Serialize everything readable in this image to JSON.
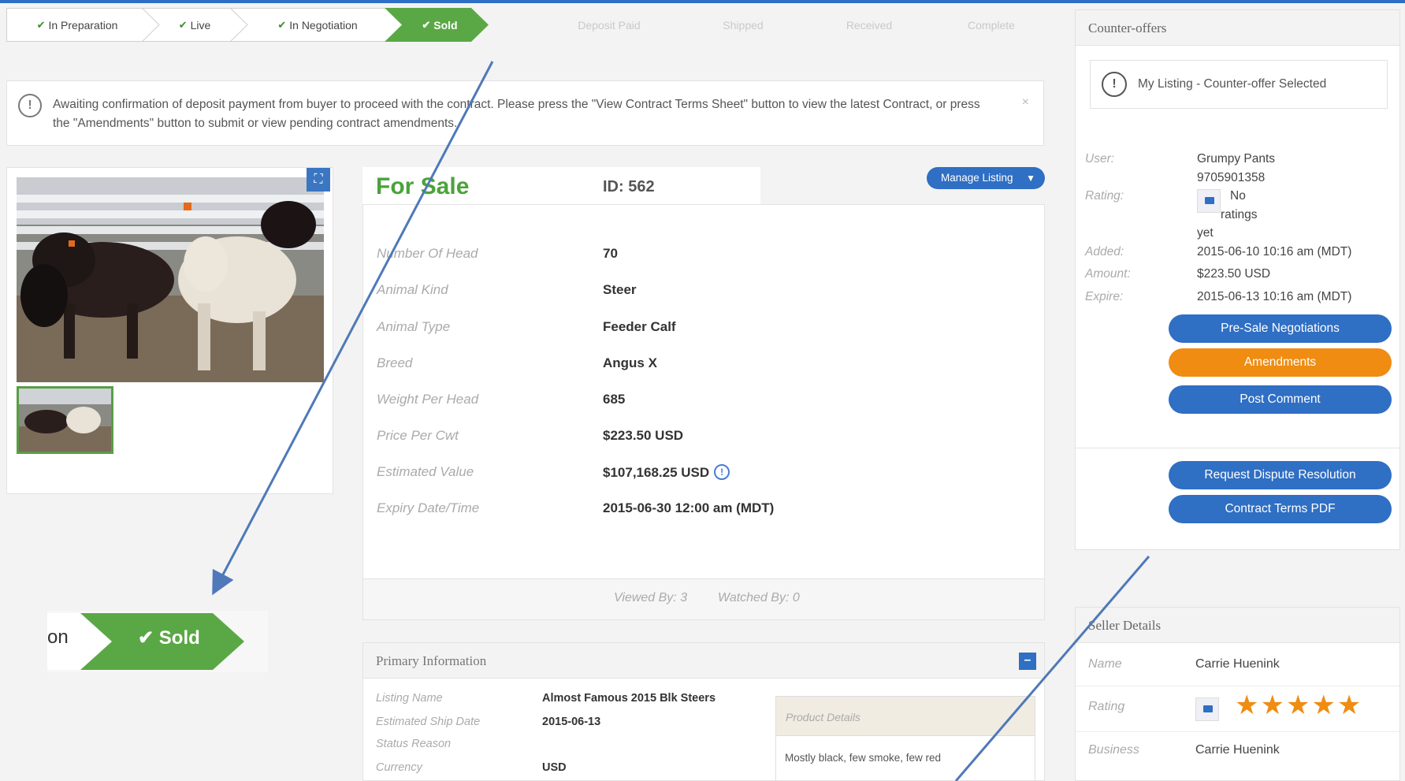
{
  "progress_steps": [
    {
      "label": "In Preparation",
      "state": "done"
    },
    {
      "label": "Live",
      "state": "done"
    },
    {
      "label": "In Negotiation",
      "state": "done"
    },
    {
      "label": "Sold",
      "state": "current"
    },
    {
      "label": "Deposit Paid",
      "state": "future"
    },
    {
      "label": "Shipped",
      "state": "future"
    },
    {
      "label": "Received",
      "state": "future"
    },
    {
      "label": "Complete",
      "state": "future"
    }
  ],
  "alert": {
    "message": "Awaiting confirmation of deposit payment from buyer to proceed with the contract. Please press the \"View Contract Terms Sheet\" button to view the latest Contract, or press the \"Amendments\" button to submit or view pending contract amendments.",
    "close": "×",
    "icon": "info-icon"
  },
  "zoom_inset": {
    "prev_label": "on",
    "current_label": "Sold"
  },
  "listing": {
    "status": "For Sale",
    "id": "ID: 562",
    "manage_label": "Manage Listing",
    "rows": [
      {
        "label": "Number Of Head",
        "value": "70"
      },
      {
        "label": "Animal Kind",
        "value": "Steer"
      },
      {
        "label": "Animal Type",
        "value": "Feeder Calf"
      },
      {
        "label": "Breed",
        "value": "Angus X"
      },
      {
        "label": "Weight Per Head",
        "value": "685"
      },
      {
        "label": "Price Per Cwt",
        "value": "$223.50 USD"
      },
      {
        "label": "Estimated Value",
        "value": "$107,168.25 USD"
      },
      {
        "label": "Expiry Date/Time",
        "value": "2015-06-30 12:00 am (MDT)"
      }
    ],
    "viewed_by": "Viewed By: 3",
    "watched_by": "Watched By: 0"
  },
  "primary": {
    "title": "Primary Information",
    "collapse": "–",
    "rows": [
      {
        "label": "Listing Name",
        "value": "Almost Famous 2015 Blk Steers"
      },
      {
        "label": "Estimated Ship Date",
        "value": "2015-06-13"
      },
      {
        "label": "Status Reason",
        "value": ""
      },
      {
        "label": "Currency",
        "value": "USD"
      }
    ],
    "product_details_label": "Product Details",
    "product_details_text": "Mostly black, few smoke, few red"
  },
  "counter_offers": {
    "title": "Counter-offers",
    "selected_text": "My Listing - Counter-offer Selected",
    "user_label": "User:",
    "user_name": "Grumpy Pants",
    "user_phone": "9705901358",
    "rating_label": "Rating:",
    "rating_text_1": "No",
    "rating_text_2": "ratings",
    "rating_text_3": "yet",
    "added_label": "Added:",
    "added_value": "2015-06-10 10:16 am (MDT)",
    "amount_label": "Amount:",
    "amount_value": "$223.50 USD",
    "expire_label": "Expire:",
    "expire_value": "2015-06-13 10:16 am (MDT)",
    "buttons": {
      "presale": "Pre-Sale Negotiations",
      "amendments": "Amendments",
      "post_comment": "Post Comment",
      "dispute": "Request Dispute Resolution",
      "contract_pdf": "Contract Terms PDF"
    }
  },
  "seller": {
    "title": "Seller Details",
    "name_label": "Name",
    "name_value": "Carrie Huenink",
    "rating_label": "Rating",
    "stars": "★★★★★",
    "business_label": "Business",
    "business_value": "Carrie Huenink"
  },
  "colors": {
    "green": "#4aa33a",
    "blue": "#2f6fc4",
    "orange": "#f08c12"
  }
}
